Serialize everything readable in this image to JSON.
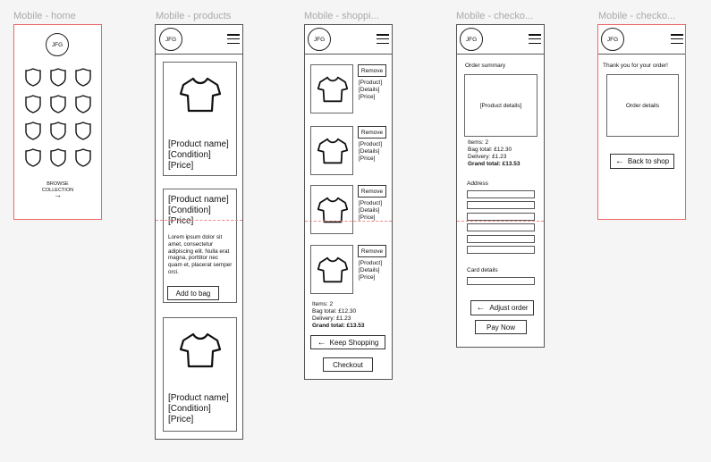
{
  "frames": {
    "home": {
      "title": "Mobile - home"
    },
    "products": {
      "title": "Mobile - products"
    },
    "shopping": {
      "title": "Mobile - shoppi..."
    },
    "checkout1": {
      "title": "Mobile - checko..."
    },
    "checkout2": {
      "title": "Mobile - checko..."
    }
  },
  "logo_text": "JFG",
  "home": {
    "browse_label": "BROWSE\nCOLLECTION",
    "arrow": "→"
  },
  "products": {
    "product_text": "[Product name]\n[Condition]\n[Price]",
    "lorem": "Lorem ipsum dolor sit amet, consectetur adipiscing elit. Nulla erat magna, porttitor nec quam et, placerat semper orci.",
    "add_to_bag": "Add to bag"
  },
  "shopping": {
    "remove_label": "Remove",
    "item_details": "[Product]\n[Details]\n[Price]",
    "items": "Items: 2",
    "bag_total": "Bag total: £12.30",
    "delivery": "Delivery: £1.23",
    "grand_total": "Grand total: £13.53",
    "keep_shopping": "Keep Shopping",
    "checkout": "Checkout"
  },
  "checkout1": {
    "order_summary": "Order summary",
    "product_details": "[Product details]",
    "items": "Items: 2",
    "bag_total": "Bag total: £12.30",
    "delivery": "Delivery: £1.23",
    "grand_total": "Grand total: £13.53",
    "address_label": "Address",
    "card_label": "Card details",
    "adjust_order": "Adjust order",
    "pay_now": "Pay Now"
  },
  "checkout2": {
    "thank_you": "Thank you for your order!",
    "order_details": "Order details",
    "back_to_shop": "Back to shop"
  },
  "icons": {
    "shield": "shield-icon",
    "tshirt": "tshirt-icon",
    "arrow_left": "arrow-left-icon",
    "arrow_right": "arrow-right-icon",
    "menu": "hamburger-menu-icon"
  }
}
